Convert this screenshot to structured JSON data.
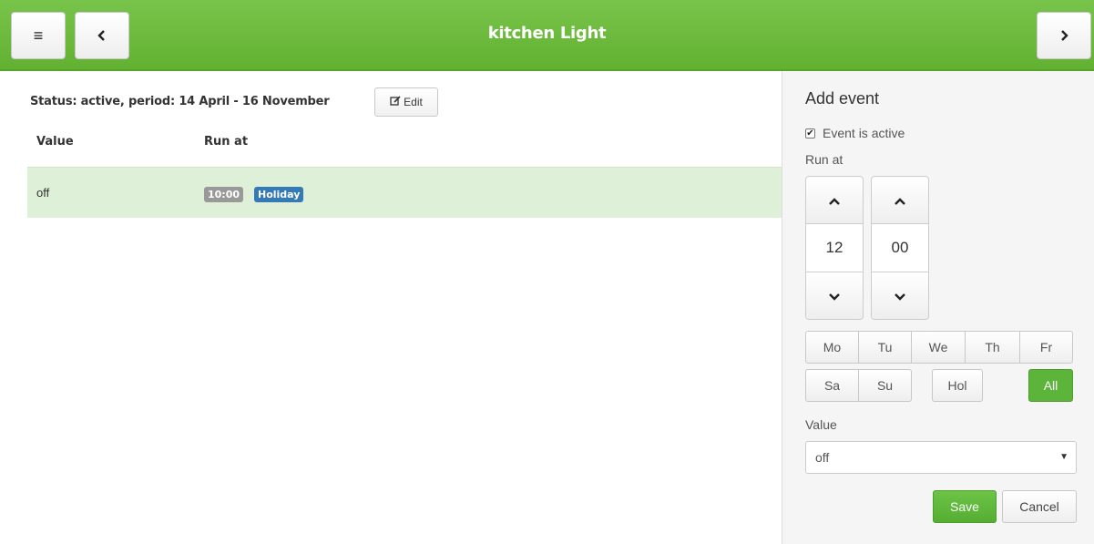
{
  "header": {
    "title": "kitchen Light",
    "menu_icon": "menu-icon",
    "back_icon": "chevron-left-icon",
    "next_icon": "chevron-right-icon",
    "accent_color": "#6ab93a"
  },
  "main": {
    "status": "Status: active, period: 14 April - 16 November",
    "edit_label": "Edit",
    "columns": [
      "Value",
      "Run at"
    ],
    "rows": [
      {
        "value": "off",
        "time": "10:00",
        "tag": "Holiday"
      }
    ]
  },
  "panel": {
    "title": "Add event",
    "active_label": "Event is active",
    "active_checked": true,
    "runat_label": "Run at",
    "hour": "12",
    "minute": "00",
    "days_row1": [
      "Mo",
      "Tu",
      "We",
      "Th",
      "Fr"
    ],
    "days_row2": [
      "Sa",
      "Su"
    ],
    "hol_label": "Hol",
    "all_label": "All",
    "value_label": "Value",
    "value_selected": "off",
    "save_label": "Save",
    "cancel_label": "Cancel"
  }
}
